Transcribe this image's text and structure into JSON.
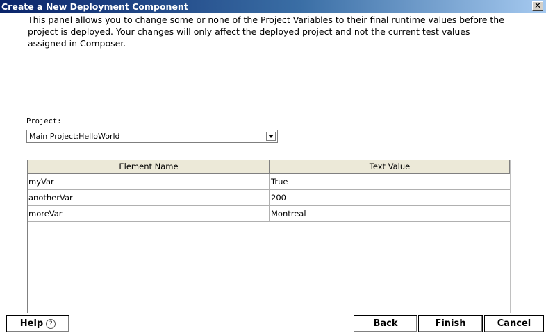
{
  "window": {
    "title": "Create a New Deployment Component",
    "close_glyph": "✕"
  },
  "description": {
    "lines": [
      "This panel allows you to change some or none of the Project Variables to their final runtime values before the",
      "project is deployed.  Your changes will only affect the deployed project and not the current test values",
      "assigned in Composer."
    ]
  },
  "project": {
    "label": "Project:",
    "selected": "Main Project:HelloWorld",
    "dropdown_icon": "chevron-down-icon"
  },
  "table": {
    "columns": [
      "Element Name",
      "Text Value"
    ],
    "rows": [
      [
        "myVar",
        "True"
      ],
      [
        "anotherVar",
        "200"
      ],
      [
        "moreVar",
        "Montreal"
      ]
    ]
  },
  "buttons": {
    "help": "Help",
    "help_icon": "help-circle-icon",
    "help_glyph": "?",
    "back": "Back",
    "finish": "Finish",
    "cancel": "Cancel"
  }
}
